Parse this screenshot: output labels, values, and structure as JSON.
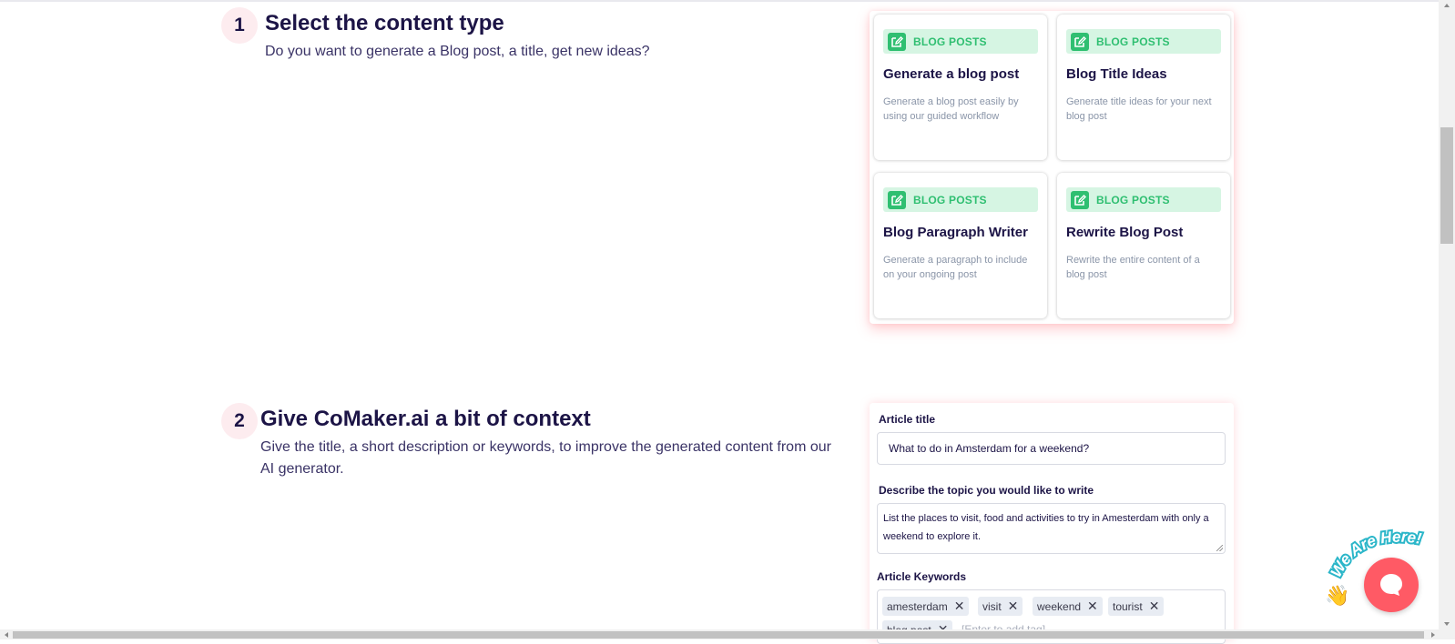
{
  "step1": {
    "number": "1",
    "title": "Select the content type",
    "description": "Do you want to generate a Blog post, a title, get new ideas?"
  },
  "cards": [
    {
      "tag": "BLOG POSTS",
      "title": "Generate a blog post",
      "description": "Generate a blog post easily by using our guided workflow",
      "icon": "edit-icon"
    },
    {
      "tag": "BLOG POSTS",
      "title": "Blog Title Ideas",
      "description": "Generate title ideas for your next blog post",
      "icon": "edit-icon"
    },
    {
      "tag": "BLOG POSTS",
      "title": "Blog Paragraph Writer",
      "description": "Generate a paragraph to include on your ongoing post",
      "icon": "edit-icon"
    },
    {
      "tag": "BLOG POSTS",
      "title": "Rewrite Blog Post",
      "description": "Rewrite the entire content of a blog post",
      "icon": "edit-icon"
    }
  ],
  "step2": {
    "number": "2",
    "title": "Give CoMaker.ai a bit of context",
    "description": "Give the title, a short description or keywords, to improve the generated content from our AI generator."
  },
  "form": {
    "article_title_label": "Article title",
    "article_title_value": "What to do in Amsterdam for a weekend?",
    "topic_label": "Describe the topic you would like to write",
    "topic_value": "List the places to visit, food and activities to try in Amesterdam with only a weekend to explore it.",
    "keywords_label": "Article Keywords",
    "keywords": [
      "amesterdam",
      "visit",
      "weekend",
      "tourist",
      "blog post"
    ],
    "keyword_remove_glyph": "✕",
    "keywords_placeholder": "[Enter to add tag]"
  },
  "chat_widget": {
    "ribbon_text": "We Are Here!",
    "wave_emoji": "👋"
  },
  "colors": {
    "accent": "#ff5a65",
    "tag_bg": "#d6f5e3",
    "tag_text": "#2fbf71",
    "heading": "#1c1446",
    "badge_bg": "#fdecef",
    "ribbon": "#2bb6c9"
  }
}
